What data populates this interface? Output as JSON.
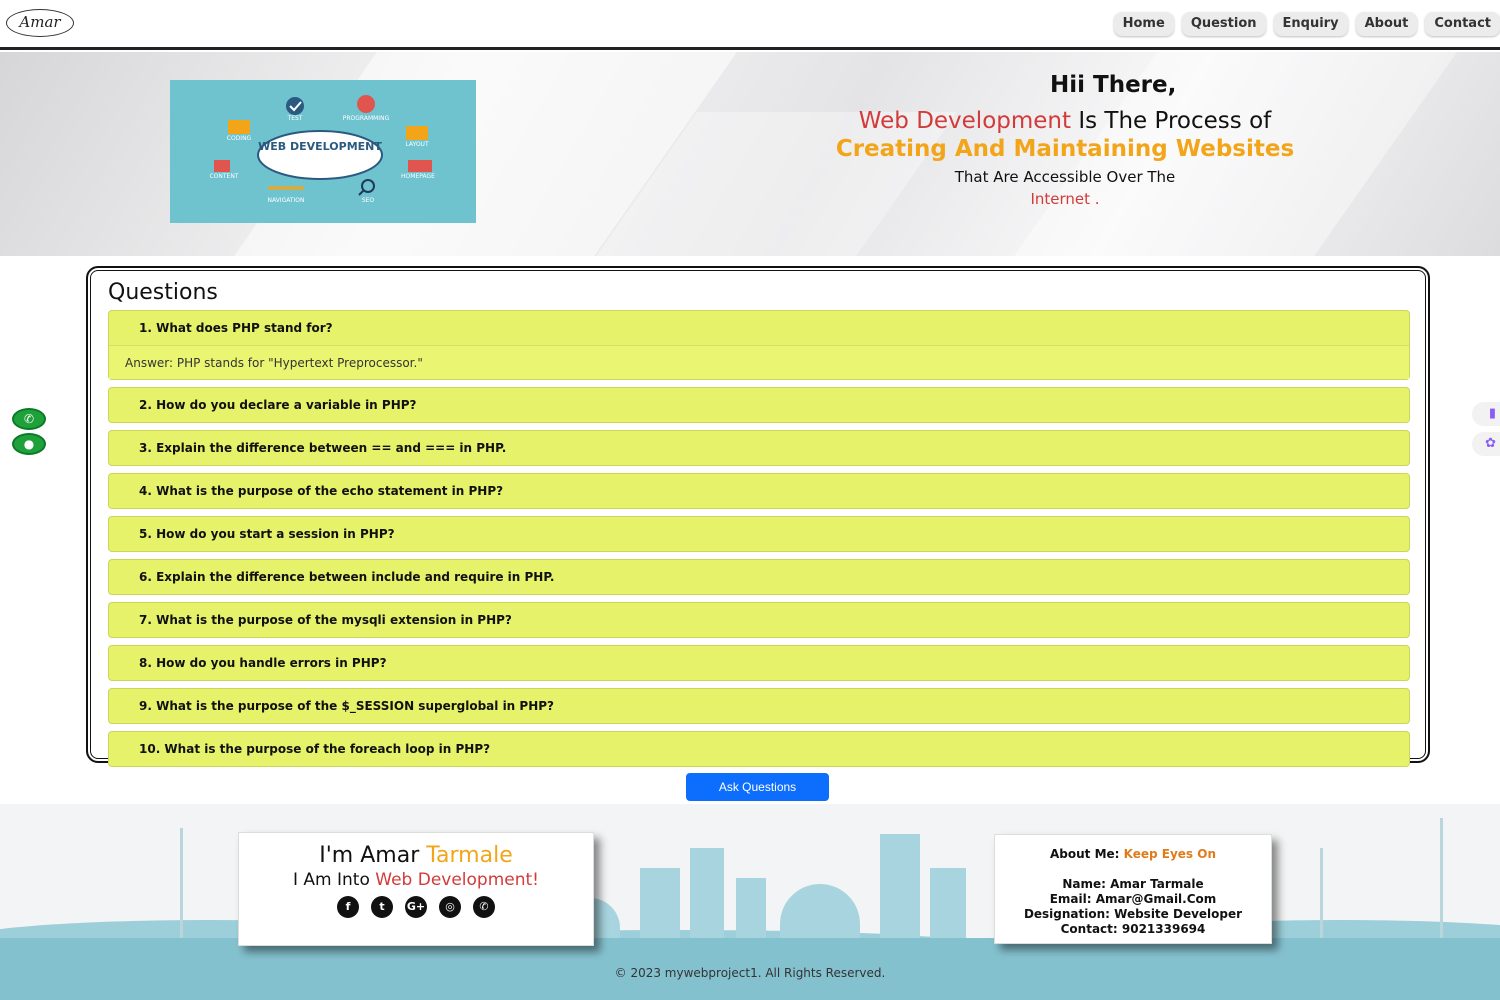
{
  "nav": {
    "logo": "Amar",
    "links": [
      "Home",
      "Question",
      "Enquiry",
      "About",
      "Contact"
    ]
  },
  "hero": {
    "greeting": "Hii There,",
    "line1_accent": "Web Development",
    "line1_rest": " Is The Process of",
    "line2": "Creating And Maintaining Websites",
    "line3": "That Are Accessible Over The",
    "line4": "Internet .",
    "image_labels": {
      "center": "WEB DEVELOPMENT",
      "test": "TEST",
      "programming": "PROGRAMMING",
      "coding": "CODING",
      "layout": "LAYOUT",
      "content": "CONTENT",
      "homepage": "HOMEPAGE",
      "navigation": "NAVIGATION",
      "seo": "SEO"
    }
  },
  "questions": {
    "title": "Questions",
    "items": [
      {
        "q": "1. What does PHP stand for?",
        "a": "Answer: PHP stands for \"Hypertext Preprocessor.\""
      },
      {
        "q": "2. How do you declare a variable in PHP?"
      },
      {
        "q": "3. Explain the difference between == and === in PHP."
      },
      {
        "q": "4. What is the purpose of the echo statement in PHP?"
      },
      {
        "q": "5. How do you start a session in PHP?"
      },
      {
        "q": "6. Explain the difference between include and require in PHP."
      },
      {
        "q": "7. What is the purpose of the mysqli extension in PHP?"
      },
      {
        "q": "8. How do you handle errors in PHP?"
      },
      {
        "q": "9. What is the purpose of the $_SESSION superglobal in PHP?"
      },
      {
        "q": "10. What is the purpose of the foreach loop in PHP?"
      }
    ],
    "ask_button": "Ask Questions"
  },
  "footer": {
    "intro_prefix": "I'm Amar ",
    "intro_accent": "Tarmale",
    "tagline_prefix": "I Am Into ",
    "tagline_accent": "Web Development!",
    "socials": [
      {
        "icon": "facebook-icon",
        "glyph": "f"
      },
      {
        "icon": "twitter-icon",
        "glyph": "t"
      },
      {
        "icon": "google-plus-icon",
        "glyph": "G+"
      },
      {
        "icon": "instagram-icon",
        "glyph": "◎"
      },
      {
        "icon": "whatsapp-icon",
        "glyph": "✆"
      }
    ],
    "about_label": "About Me: ",
    "about_accent": "Keep Eyes On",
    "name": "Name: Amar Tarmale",
    "email": "Email: Amar@Gmail.Com",
    "designation": "Designation: Website Developer",
    "contact": "Contact: 9021339694",
    "copyright": "© 2023 mywebproject1. All Rights Reserved."
  },
  "colors": {
    "accent_red": "#d33a3a",
    "accent_orange": "#f3a51a",
    "question_bg": "#e6f26a",
    "button_blue": "#0d6efd"
  }
}
